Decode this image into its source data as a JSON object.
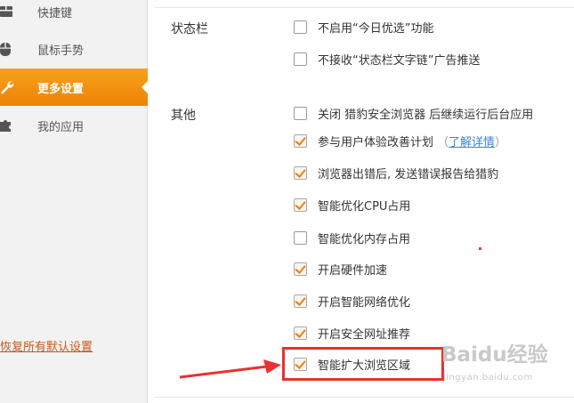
{
  "sidebar": {
    "items": [
      {
        "label": "快捷键",
        "icon": "keyboard-icon",
        "active": false
      },
      {
        "label": "鼠标手势",
        "icon": "mouse-icon",
        "active": false
      },
      {
        "label": "更多设置",
        "icon": "wrench-icon",
        "active": true
      },
      {
        "label": "我的应用",
        "icon": "puzzle-icon",
        "active": false
      }
    ],
    "restore_link": "恢复所有默认设置"
  },
  "sections": {
    "status_bar": {
      "title": "状态栏",
      "options": [
        {
          "label": "不启用“今日优选”功能",
          "checked": false
        },
        {
          "label": "不接收“状态栏文字链”广告推送",
          "checked": false
        }
      ]
    },
    "other": {
      "title": "其他",
      "options": [
        {
          "label": "关闭 猎豹安全浏览器 后继续运行后台应用",
          "checked": false
        },
        {
          "label": "参与用户体验改善计划",
          "checked": true,
          "detail_link": "了解详情"
        },
        {
          "label": "浏览器出错后, 发送错误报告给猎豹",
          "checked": true
        },
        {
          "label": "智能优化CPU占用",
          "checked": true
        },
        {
          "label": "智能优化内存占用",
          "checked": false
        },
        {
          "label": "开启硬件加速",
          "checked": true
        },
        {
          "label": "开启智能网络优化",
          "checked": true
        },
        {
          "label": "开启安全网址推荐",
          "checked": true
        },
        {
          "label": "智能扩大浏览区域",
          "checked": true,
          "highlighted": true
        }
      ]
    }
  },
  "detail_open": "（",
  "detail_close": "）",
  "watermark": {
    "main": "Baidu经验",
    "sub": "jingyan.baidu.com"
  },
  "colors": {
    "accent": "#ee8208",
    "highlight": "#e8322f",
    "link": "#3b86d1",
    "restore": "#c8571a"
  }
}
